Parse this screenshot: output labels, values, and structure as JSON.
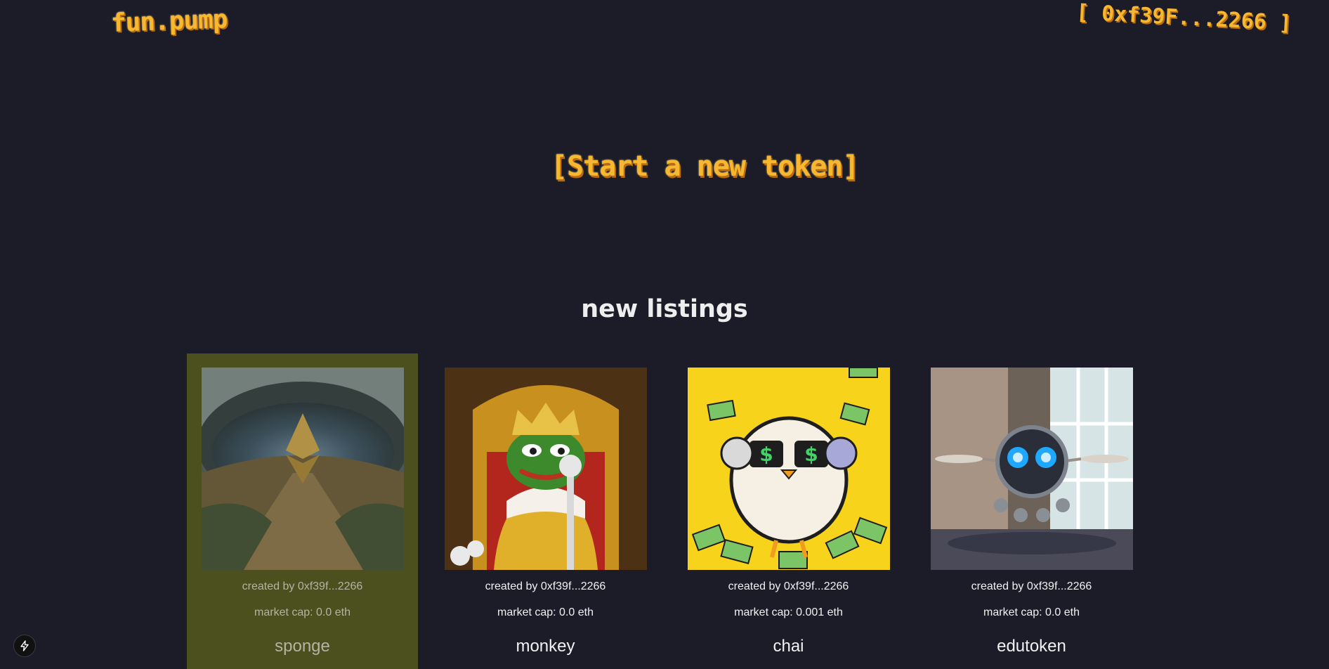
{
  "header": {
    "logo": "fun.pump",
    "wallet": "[ 0xf39F...2266 ]"
  },
  "hero": {
    "cta": "[Start a new token]"
  },
  "listings": {
    "title": "new listings",
    "items": [
      {
        "image_icon": "eye-ethereum-image",
        "creator": "created by 0xf39f...2266",
        "market_cap": "market cap: 0.0 eth",
        "name": "sponge",
        "highlighted": true
      },
      {
        "image_icon": "pepe-king-image",
        "creator": "created by 0xf39f...2266",
        "market_cap": "market cap: 0.0 eth",
        "name": "monkey",
        "highlighted": false
      },
      {
        "image_icon": "chai-duck-image",
        "creator": "created by 0xf39f...2266",
        "market_cap": "market cap: 0.001 eth",
        "name": "chai",
        "highlighted": false
      },
      {
        "image_icon": "robot-drone-image",
        "creator": "created by 0xf39f...2266",
        "market_cap": "market cap: 0.0 eth",
        "name": "edutoken",
        "highlighted": false
      }
    ]
  },
  "colors": {
    "background": "#1b1c27",
    "accent": "#f7b731",
    "highlight_card": "#4c4f1e"
  }
}
